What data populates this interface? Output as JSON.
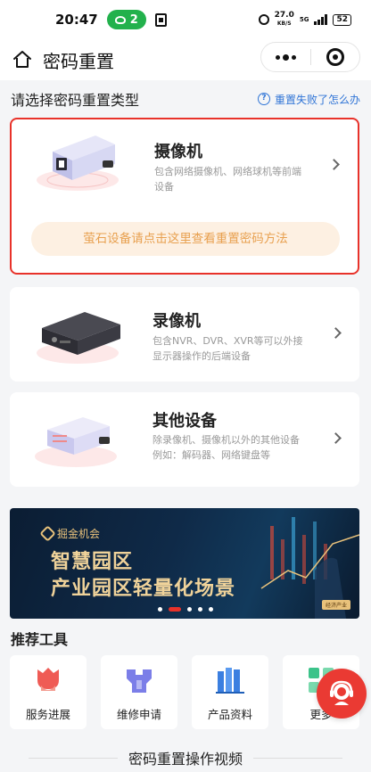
{
  "status_bar": {
    "time": "20:47",
    "wechat_badge": "2",
    "net_speed": "27.0",
    "net_unit": "KB/S",
    "network_type": "5G",
    "battery": "52"
  },
  "nav": {
    "title": "密码重置"
  },
  "section": {
    "title": "请选择密码重置类型",
    "help_link": "重置失败了怎么办"
  },
  "cards": {
    "camera": {
      "title": "摄像机",
      "desc": "包含网络摄像机、网络球机等前端设备",
      "ezviz_tip": "萤石设备请点击这里查看重置密码方法"
    },
    "recorder": {
      "title": "录像机",
      "desc": "包含NVR、DVR、XVR等可以外接显示器操作的后端设备"
    },
    "other": {
      "title": "其他设备",
      "desc": "除录像机、摄像机以外的其他设备例如：解码器、网络键盘等"
    }
  },
  "banner": {
    "logo_text": "掘金机会",
    "line1": "智慧园区",
    "line2": "产业园区轻量化场景",
    "badge": "经济产业",
    "active_slide": 2,
    "slide_count": 5
  },
  "tools": {
    "title": "推荐工具",
    "items": [
      {
        "label": "服务进展",
        "icon": "tulip-icon"
      },
      {
        "label": "维修申请",
        "icon": "wrench-icon"
      },
      {
        "label": "产品资料",
        "icon": "books-icon"
      },
      {
        "label": "更多",
        "icon": "grid-icon"
      }
    ]
  },
  "video": {
    "title": "密码重置操作视频"
  },
  "colors": {
    "accent_blue": "#2f74d6",
    "highlight_red": "#e8322a",
    "tip_orange": "#e8a04f",
    "tip_bg": "#fdf0e2"
  }
}
